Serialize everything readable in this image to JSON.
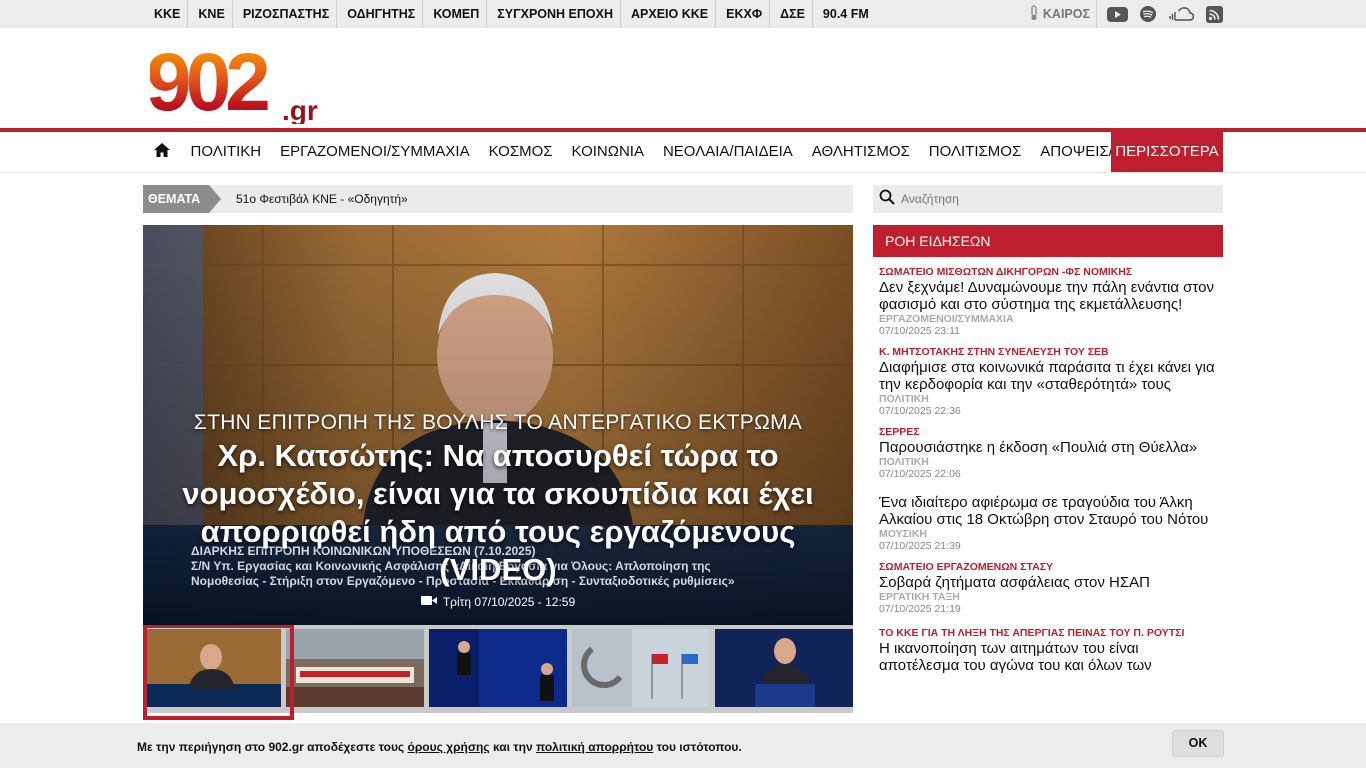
{
  "topbar": {
    "links": [
      "ΚΚΕ",
      "ΚΝΕ",
      "ΡΙΖΟΣΠΑΣΤΗΣ",
      "ΟΔΗΓΗΤΗΣ",
      "ΚΟΜΕΠ",
      "ΣΥΓΧΡΟΝΗ ΕΠΟΧΗ",
      "ΑΡΧΕΙΟ ΚΚΕ",
      "ΕΚΧΦ",
      "ΔΣΕ",
      "90.4 FM"
    ],
    "weather_label": "ΚΑΙΡΟΣ",
    "social_icons": [
      "youtube-icon",
      "spotify-icon",
      "soundcloud-icon",
      "rss-icon"
    ]
  },
  "logo": {
    "main": "902",
    "suffix": ".gr"
  },
  "nav": {
    "items": [
      "ΠΟΛΙΤΙΚΗ",
      "ΕΡΓΑΖΟΜΕΝΟΙ/ΣΥΜΜΑΧΙΑ",
      "ΚΟΣΜΟΣ",
      "ΚΟΙΝΩΝΙΑ",
      "ΝΕΟΛΑΙΑ/ΠΑΙΔΕΙΑ",
      "ΑΘΛΗΤΙΣΜΟΣ",
      "ΠΟΛΙΤΙΣΜΟΣ",
      "ΑΠΟΨΕΙΣ/ΣΧΟΛΙΑ"
    ],
    "more": "ΠΕΡΙΣΣΟΤΕΡΑ"
  },
  "themata": {
    "label": "ΘΕΜΑΤΑ",
    "topic": "51ο Φεστιβάλ ΚΝΕ - «Οδηγητή»"
  },
  "hero": {
    "kicker": "ΣΤΗΝ ΕΠΙΤΡΟΠΗ ΤΗΣ ΒΟΥΛΗΣ ΤΟ ΑΝΤΕΡΓΑΤΙΚΟ ΕΚΤΡΩΜΑ",
    "title": "Χρ. Κατσώτης: Να αποσυρθεί τώρα το νομοσχέδιο, είναι για τα σκουπίδια και έχει απορριφθεί ήδη από τους εργαζόμενους (VIDEO)",
    "date": "Τρίτη 07/10/2025 - 12:59",
    "banner_line1": "ΔΙΑΡΚΗΣ ΕΠΙΤΡΟΠΗ ΚΟΙΝΩΝΙΚΩΝ ΥΠΟΘΕΣΕΩΝ (7.10.2025)",
    "banner_line2": "Σ/Ν Υπ. Εργασίας και Κοινωνικής Ασφάλισης «Δίκαιη Εργασία για Όλους: Απλοποίηση της",
    "banner_line3": "Νομοθεσίας - Στήριξη στον Εργαζόμενο - Προστασία - Εκκαθάριση - Συνταξιοδοτικές ρυθμίσεις»"
  },
  "search": {
    "placeholder": "Αναζήτηση"
  },
  "feed": {
    "heading": "ΡΟΗ ΕΙΔΗΣΕΩΝ",
    "items": [
      {
        "cat": "ΣΩΜΑΤΕΙΟ ΜΙΣΘΩΤΩΝ ΔΙΚΗΓΟΡΩΝ -ΦΣ ΝΟΜΙΚΗΣ",
        "title": "Δεν ξεχνάμε! Δυναμώνουμε την πάλη ενάντια στον φασισμό και στο σύστημα της εκμετάλλευσης!",
        "section": "ΕΡΓΑΖΟΜΕΝΟΙ/ΣΥΜΜΑΧΙΑ",
        "date": "07/10/2025 23:11"
      },
      {
        "cat": "Κ. ΜΗΤΣΟΤΑΚΗΣ ΣΤΗΝ ΣΥΝΕΛΕΥΣΗ ΤΟΥ ΣΕΒ",
        "title": "Διαφήμισε στα κοινωνικά παράσιτα τι έχει κάνει για την κερδοφορία και την «σταθερότητά» τους",
        "section": "ΠΟΛΙΤΙΚΗ",
        "date": "07/10/2025 22:36"
      },
      {
        "cat": "ΣΕΡΡΕΣ",
        "title": "Παρουσιάστηκε η έκδοση «Πουλιά στη Θύελλα»",
        "section": "ΠΟΛΙΤΙΚΗ",
        "date": "07/10/2025 22:06"
      },
      {
        "cat": "",
        "title": "Ένα ιδιαίτερο αφιέρωμα σε τραγούδια του Άλκη Αλκαίου στις 18 Οκτώβρη στον Σταυρό του Νότου",
        "section": "ΜΟΥΣΙΚΗ",
        "date": "07/10/2025 21:39"
      },
      {
        "cat": "ΣΩΜΑΤΕΙΟ ΕΡΓΑΖΟΜΕΝΩΝ ΣΤΑΣΥ",
        "title": "Σοβαρά ζητήματα ασφάλειας στον ΗΣΑΠ",
        "section": "ΕΡΓΑΤΙΚΗ ΤΑΞΗ",
        "date": "07/10/2025 21:19"
      },
      {
        "cat": "ΤΟ ΚΚΕ ΓΙΑ ΤΗ ΛΗΞΗ ΤΗΣ ΑΠΕΡΓΙΑΣ ΠΕΙΝΑΣ ΤΟΥ Π. ΡΟΥΤΣΙ",
        "title": "Η ικανοποίηση των αιτημάτων του είναι αποτέλεσμα του αγώνα του και όλων των",
        "section": "",
        "date": ""
      }
    ]
  },
  "cookie": {
    "text_before": "Με την περιήγηση στο 902.gr αποδέχεστε τους ",
    "link_terms": "όρους χρήσης",
    "text_mid": " και την ",
    "link_privacy": "πολιτική απορρήτου",
    "text_after": " του ιστότοπου.",
    "ok": "OK"
  },
  "colors": {
    "accent": "#bf1e2e",
    "topbar_bg": "#ececec"
  }
}
